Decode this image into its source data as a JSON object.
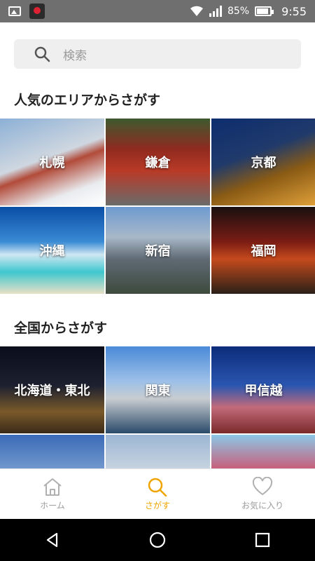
{
  "status": {
    "battery": "85%",
    "time": "9:55"
  },
  "search": {
    "placeholder": "検索"
  },
  "popular": {
    "title": "人気のエリアからさがす",
    "tiles": [
      {
        "label": "札幌",
        "bg": "linear-gradient(160deg,#8cb0d6 0%,#cfd7e0 45%,#b24b3a 55%,#e9ecef 80%,#ffffff 100%)"
      },
      {
        "label": "鎌倉",
        "bg": "linear-gradient(180deg,#3d5a2f 0%,#8f2a1f 35%,#b93a27 60%,#6b6b6b 100%)"
      },
      {
        "label": "京都",
        "bg": "linear-gradient(160deg,#0d2d6e 0%,#203a6b 40%,#8a5b14 65%,#e0a03a 100%)"
      },
      {
        "label": "沖縄",
        "bg": "linear-gradient(180deg,#0a4ea6 0%,#3a8ad4 40%,#cfe7f2 55%,#3fc7cf 75%,#e9e0c5 100%)"
      },
      {
        "label": "新宿",
        "bg": "linear-gradient(180deg,#6e9ad0 0%,#a8b8c8 35%,#5f6a74 60%,#3d4a3c 100%)"
      },
      {
        "label": "福岡",
        "bg": "linear-gradient(180deg,#1a1010 0%,#7a1c14 40%,#c54a1d 60%,#2a2018 100%)"
      }
    ]
  },
  "national": {
    "title": "全国からさがす",
    "tiles": [
      {
        "label": "北海道・東北",
        "bg": "linear-gradient(180deg,#0a0d1a 0%,#1d2030 45%,#7a5a2a 75%,#3a2a18 100%)"
      },
      {
        "label": "関東",
        "bg": "linear-gradient(180deg,#4a8ad8 0%,#9dc0e8 40%,#c8ccd0 60%,#2a4a6a 100%)"
      },
      {
        "label": "甲信越",
        "bg": "linear-gradient(180deg,#0c2c7a 0%,#2a56b0 45%,#c26a7a 70%,#7a2a2a 100%)"
      },
      {
        "label": "",
        "bg": "linear-gradient(180deg,#3a6bb8 0%,#8fb0d8 60%,#e8eef4 100%)"
      },
      {
        "label": "",
        "bg": "linear-gradient(180deg,#9cb6d4 0%,#cdd8e2 45%,#6b7a4a 100%)"
      },
      {
        "label": "",
        "bg": "linear-gradient(180deg,#8cc8e8 0%,#d8405a 50%,#e8c040 100%)"
      }
    ]
  },
  "nav": {
    "home": "ホーム",
    "search": "さがす",
    "favorites": "お気に入り"
  },
  "colors": {
    "accent": "#f0a400"
  }
}
